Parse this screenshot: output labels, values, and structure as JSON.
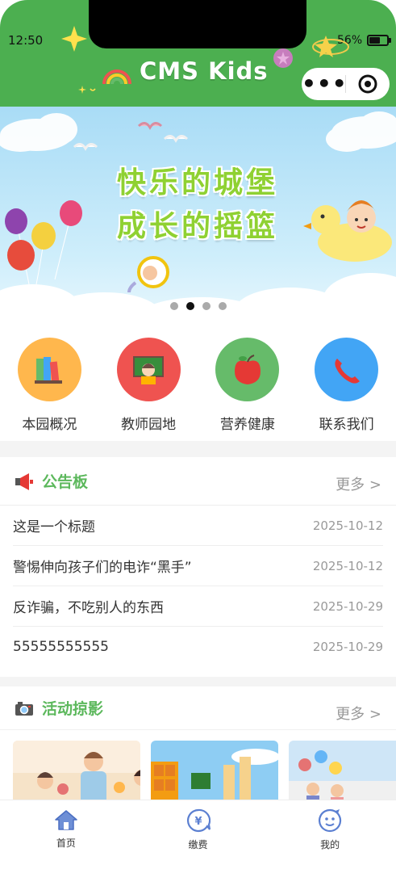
{
  "status_bar": {
    "time": "12:50",
    "battery": "56%",
    "battery_level": 0.56
  },
  "header": {
    "title": "CMS Kids",
    "bg_color": "#4caf50"
  },
  "banner": {
    "slogan_line1": "快乐的城堡",
    "slogan_line2": "成长的摇篮",
    "active_slide": 2,
    "slide_count": 4
  },
  "quick_nav": [
    {
      "label": "本园概况",
      "icon": "books-icon",
      "color": "#ffb74d"
    },
    {
      "label": "教师园地",
      "icon": "teacher-icon",
      "color": "#ef5350"
    },
    {
      "label": "营养健康",
      "icon": "apple-icon",
      "color": "#66bb6a"
    },
    {
      "label": "联系我们",
      "icon": "phone-icon",
      "color": "#42a5f5"
    }
  ],
  "notice": {
    "title": "公告板",
    "more": "更多 >",
    "items": [
      {
        "title": "这是一个标题",
        "date": "2025-10-12"
      },
      {
        "title": "警惕伸向孩子们的电诈“黑手”",
        "date": "2025-10-12"
      },
      {
        "title": "反诈骗，不吃别人的东西",
        "date": "2025-10-29"
      },
      {
        "title": "55555555555",
        "date": "2025-10-29"
      }
    ]
  },
  "photos": {
    "title": "活动掠影",
    "more": "更多 >"
  },
  "tabbar": [
    {
      "label": "首页",
      "icon": "home-icon"
    },
    {
      "label": "缴费",
      "icon": "payment-icon"
    },
    {
      "label": "我的",
      "icon": "profile-icon"
    }
  ]
}
